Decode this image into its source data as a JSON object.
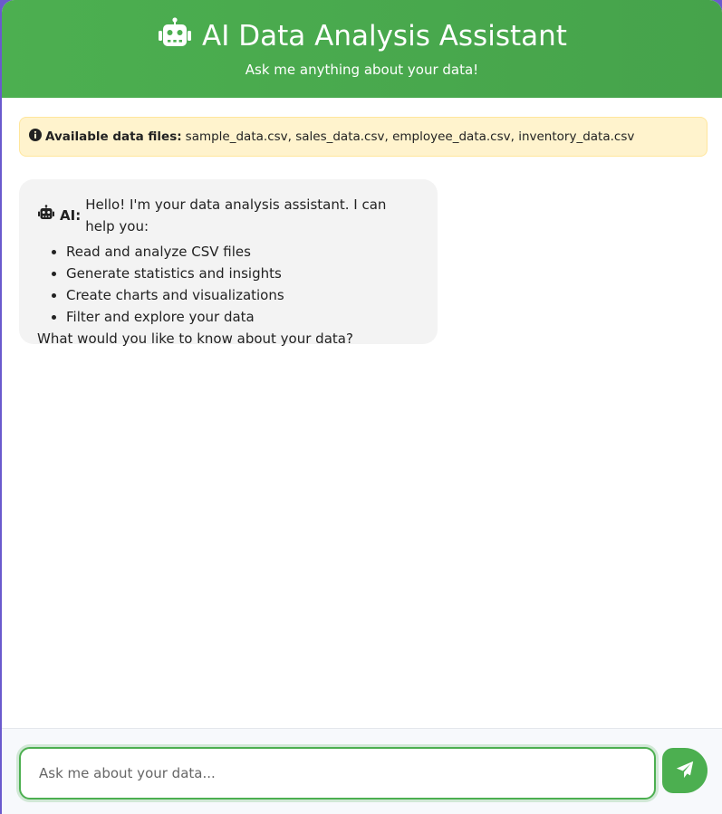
{
  "header": {
    "title": "AI Data Analysis Assistant",
    "subtitle": "Ask me anything about your data!",
    "icon": "robot-icon"
  },
  "info_bar": {
    "icon": "info-icon",
    "label": "Available data files:",
    "files": "sample_data.csv, sales_data.csv, employee_data.csv, inventory_data.csv"
  },
  "messages": [
    {
      "sender": "AI:",
      "icon": "robot-icon",
      "intro": "Hello! I'm your data analysis assistant. I can help you:",
      "items": [
        "Read and analyze CSV files",
        "Generate statistics and insights",
        "Create charts and visualizations",
        "Filter and explore your data"
      ],
      "outro": "What would you like to know about your data?"
    }
  ],
  "composer": {
    "placeholder": "Ask me about your data...",
    "send_icon": "paper-plane-icon"
  },
  "colors": {
    "accent": "#4caf50",
    "info_bg": "#fff3cd",
    "bubble_bg": "#f3f3f3"
  }
}
